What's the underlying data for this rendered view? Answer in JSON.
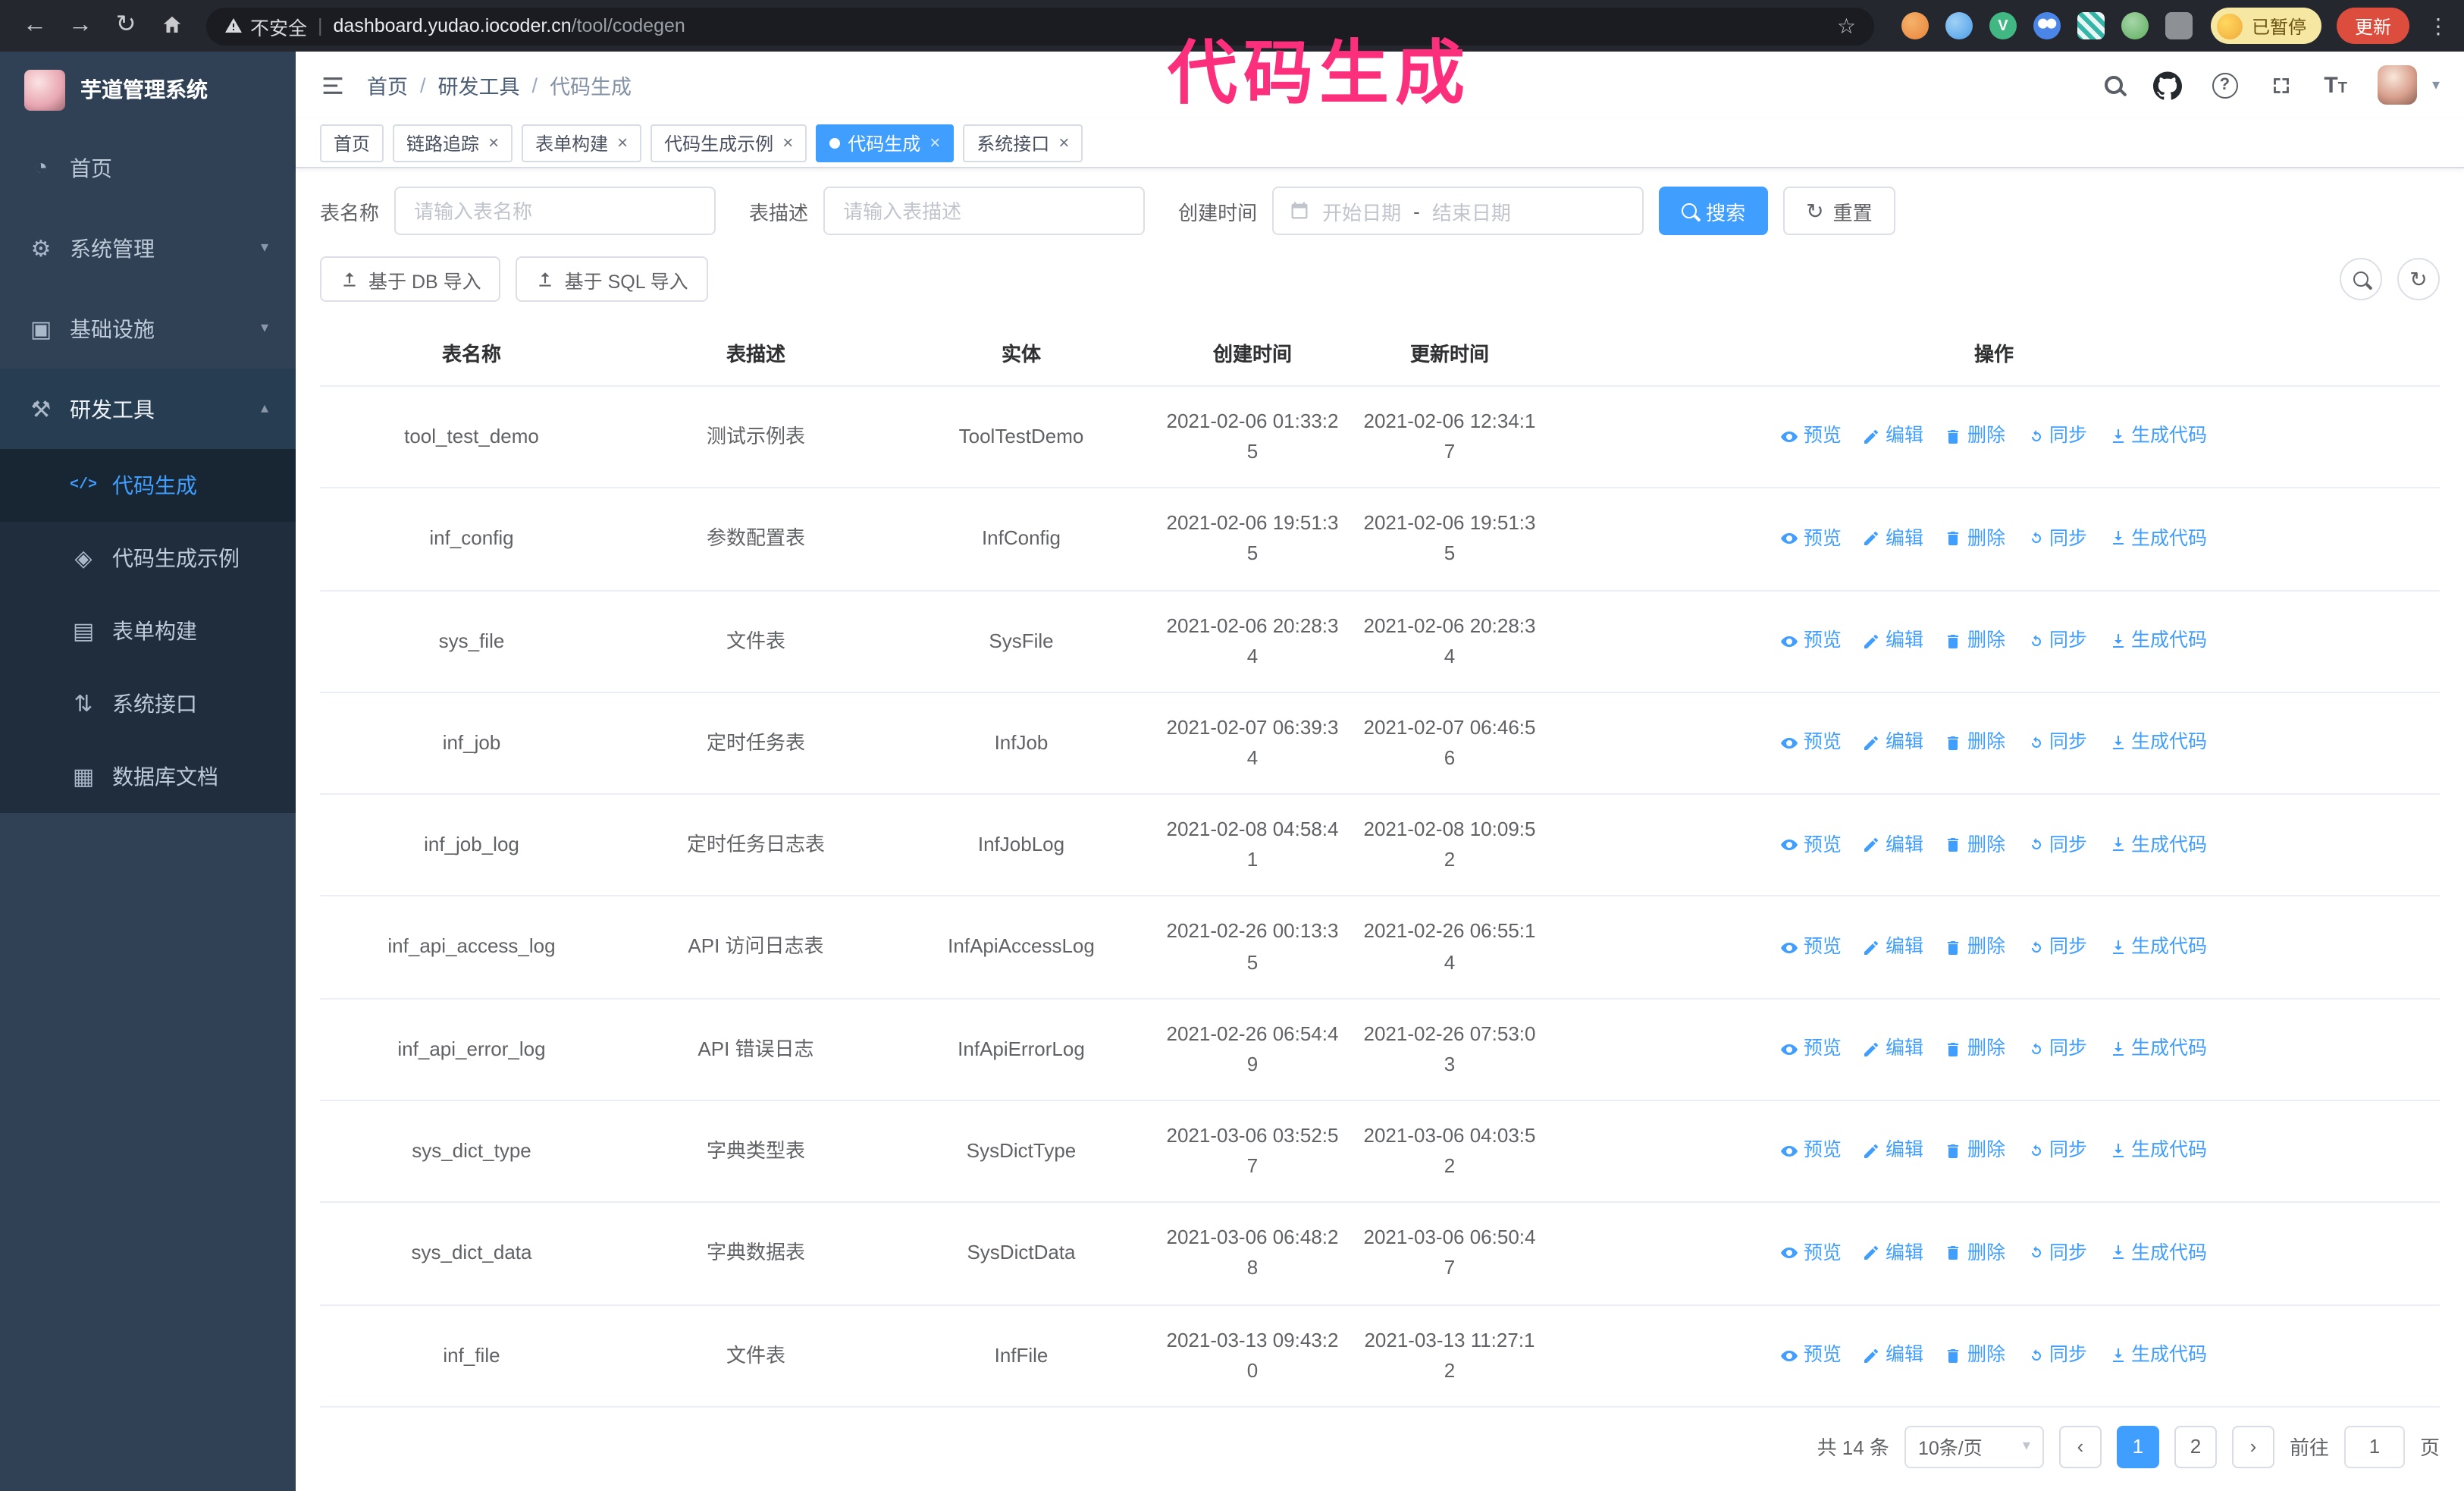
{
  "annotation": {
    "text": "代码生成",
    "color": "#fb2f7b"
  },
  "browser": {
    "security_label": "不安全",
    "url_host": "dashboard.yudao.iocoder.cn",
    "url_path": "/tool/codegen",
    "paused_badge": "已暂停",
    "update_button": "更新"
  },
  "icons": {
    "back": "←",
    "forward": "→",
    "reload": "↻",
    "bookmark_star": "☆",
    "menu_dots": "⋮",
    "divider": "|",
    "dashboard": "◔",
    "gear": "⚙",
    "infra": "▣",
    "tools": "⚒",
    "chevron_down": "▾",
    "chevron_up": "▴",
    "caret_down": "▾",
    "close": "×",
    "code": "</>",
    "example": "◈",
    "form": "▤",
    "api": "⇅",
    "dbdoc": "▦",
    "refresh": "↻",
    "question": "?",
    "vue": "V",
    "font_size_big": "T",
    "font_size_small": "T"
  },
  "sidebar": {
    "logo_title": "芋道管理系统",
    "items": [
      {
        "label": "首页"
      },
      {
        "label": "系统管理"
      },
      {
        "label": "基础设施"
      },
      {
        "label": "研发工具"
      }
    ],
    "subitems": [
      {
        "label": "代码生成"
      },
      {
        "label": "代码生成示例"
      },
      {
        "label": "表单构建"
      },
      {
        "label": "系统接口"
      },
      {
        "label": "数据库文档"
      }
    ]
  },
  "header": {
    "breadcrumb": [
      "首页",
      "研发工具",
      "代码生成"
    ],
    "breadcrumb_separator": "/"
  },
  "tabs": [
    {
      "label": "首页"
    },
    {
      "label": "链路追踪"
    },
    {
      "label": "表单构建"
    },
    {
      "label": "代码生成示例"
    },
    {
      "label": "代码生成"
    },
    {
      "label": "系统接口"
    }
  ],
  "filters": {
    "table_name_label": "表名称",
    "table_name_placeholder": "请输入表名称",
    "table_desc_label": "表描述",
    "table_desc_placeholder": "请输入表描述",
    "create_time_label": "创建时间",
    "date_start_placeholder": "开始日期",
    "date_separator": "-",
    "date_end_placeholder": "结束日期",
    "search_button": "搜索",
    "reset_button": "重置"
  },
  "toolbar": {
    "import_db_button": "基于 DB 导入",
    "import_sql_button": "基于 SQL 导入"
  },
  "table": {
    "columns": [
      "表名称",
      "表描述",
      "实体",
      "创建时间",
      "更新时间",
      "操作"
    ],
    "actions": [
      "预览",
      "编辑",
      "删除",
      "同步",
      "生成代码"
    ],
    "rows": [
      {
        "name": "tool_test_demo",
        "desc": "测试示例表",
        "entity": "ToolTestDemo",
        "created": "2021-02-06 01:33:25",
        "updated": "2021-02-06 12:34:17"
      },
      {
        "name": "inf_config",
        "desc": "参数配置表",
        "entity": "InfConfig",
        "created": "2021-02-06 19:51:35",
        "updated": "2021-02-06 19:51:35"
      },
      {
        "name": "sys_file",
        "desc": "文件表",
        "entity": "SysFile",
        "created": "2021-02-06 20:28:34",
        "updated": "2021-02-06 20:28:34"
      },
      {
        "name": "inf_job",
        "desc": "定时任务表",
        "entity": "InfJob",
        "created": "2021-02-07 06:39:34",
        "updated": "2021-02-07 06:46:56"
      },
      {
        "name": "inf_job_log",
        "desc": "定时任务日志表",
        "entity": "InfJobLog",
        "created": "2021-02-08 04:58:41",
        "updated": "2021-02-08 10:09:52"
      },
      {
        "name": "inf_api_access_log",
        "desc": "API 访问日志表",
        "entity": "InfApiAccessLog",
        "created": "2021-02-26 00:13:35",
        "updated": "2021-02-26 06:55:14"
      },
      {
        "name": "inf_api_error_log",
        "desc": "API 错误日志",
        "entity": "InfApiErrorLog",
        "created": "2021-02-26 06:54:49",
        "updated": "2021-02-26 07:53:03"
      },
      {
        "name": "sys_dict_type",
        "desc": "字典类型表",
        "entity": "SysDictType",
        "created": "2021-03-06 03:52:57",
        "updated": "2021-03-06 04:03:52"
      },
      {
        "name": "sys_dict_data",
        "desc": "字典数据表",
        "entity": "SysDictData",
        "created": "2021-03-06 06:48:28",
        "updated": "2021-03-06 06:50:47"
      },
      {
        "name": "inf_file",
        "desc": "文件表",
        "entity": "InfFile",
        "created": "2021-03-13 09:43:20",
        "updated": "2021-03-13 11:27:12"
      }
    ]
  },
  "pagination": {
    "total": "共 14 条",
    "page_size": "10条/页",
    "prev": "‹",
    "next": "›",
    "pages": [
      "1",
      "2"
    ],
    "active_page": "1",
    "goto_label": "前往",
    "goto_value": "1",
    "goto_suffix": "页"
  }
}
